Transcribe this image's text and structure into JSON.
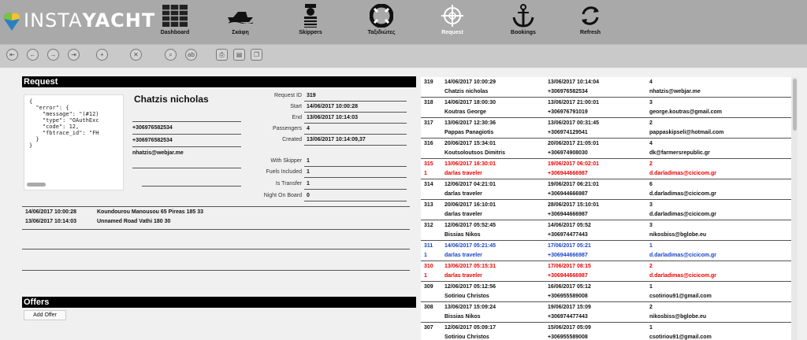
{
  "app": {
    "logo_pre": "INSTA",
    "logo_bold": "YACHT"
  },
  "nav": [
    {
      "label": "Dashboard",
      "icon": "dashboard-grid-icon"
    },
    {
      "label": "Σκάφη",
      "icon": "speedboat-icon"
    },
    {
      "label": "Skippers",
      "icon": "skipper-icon"
    },
    {
      "label": "Ταξιδιώτες",
      "icon": "lifebuoy-icon"
    },
    {
      "label": "Request",
      "icon": "compass-icon",
      "active": true
    },
    {
      "label": "Bookings",
      "icon": "anchor-icon"
    },
    {
      "label": "Refresh",
      "icon": "refresh-icon"
    }
  ],
  "toolbar": {
    "buttons": [
      "first-icon",
      "prev-icon",
      "next-icon",
      "last-icon",
      "add-icon",
      "cancel-icon",
      "search-icon",
      "find-replace-icon",
      "print-icon",
      "export-icon",
      "copy-icon"
    ]
  },
  "request": {
    "header": "Request",
    "json_text": "{\n  \"error\": {\n    \"message\": \"(#12)\n    \"type\": \"OAuthExc\n    \"code\": 12,\n    \"fbtrace_id\": \"FH\n  }\n}",
    "customer_name": "Chatzis nicholas",
    "phone1": "+306976582534",
    "phone2": "+306976582534",
    "email": "nhatzis@webjar.me",
    "fields": [
      {
        "label": "Request ID",
        "value": "319"
      },
      {
        "label": "Start",
        "value": "14/06/2017 10:00:28"
      },
      {
        "label": "End",
        "value": "13/06/2017 10:14:03"
      },
      {
        "label": "Passengers",
        "value": "4"
      },
      {
        "label": "Created",
        "value": "13/06/2017 10:14:09,37"
      },
      {
        "label": "With Skipper",
        "value": "1"
      },
      {
        "label": "Fuels Included",
        "value": "1"
      },
      {
        "label": "Is Transfer",
        "value": "1"
      },
      {
        "label": "Night On Board",
        "value": "0"
      }
    ],
    "addresses": [
      {
        "date": "14/06/2017 10:00:28",
        "address": "Koundourou Manousou 65 Pireas 185 33"
      },
      {
        "date": "13/06/2017 10:14:03",
        "address": "Unnamed Road Vathi 180 30"
      }
    ]
  },
  "offers": {
    "header": "Offers",
    "add_button": "Add Offer"
  },
  "list": [
    {
      "id": "319",
      "start": "14/06/2017 10:00:29",
      "name": "Chatzis nicholas",
      "end": "13/06/2017 10:14:04",
      "phone": "+306976582534",
      "pax": "4",
      "email": "nhatzis@webjar.me",
      "style": ""
    },
    {
      "id": "318",
      "start": "14/06/2017 18:00:30",
      "name": "Koutras George",
      "end": "13/06/2017 21:00:01",
      "phone": "+306976791019",
      "pax": "3",
      "email": "george.koutras@gmail.com",
      "style": ""
    },
    {
      "id": "317",
      "start": "13/06/2017 12:30:36",
      "name": "Pappas Panagiotis",
      "end": "13/06/2017 00:31:45",
      "phone": "+306974129541",
      "pax": "2",
      "email": "pappaskipseli@hotmail.com",
      "style": ""
    },
    {
      "id": "316",
      "start": "20/06/2017 15:34:01",
      "name": "Koutsoloutsos Dimitris",
      "end": "20/06/2017 21:05:01",
      "phone": "+306974908030",
      "pax": "4",
      "email": "dk@farmersrepublic.gr",
      "style": ""
    },
    {
      "id": "315",
      "start": "13/06/2017 16:30:01",
      "name": "darlas traveler",
      "end": "19/06/2017 06:02:01",
      "phone": "+306944666987",
      "pax": "2",
      "email": "d.darladimas@cicicom.gr",
      "style": "red",
      "sub": "1"
    },
    {
      "id": "314",
      "start": "12/06/2017 04:21:01",
      "name": "darlas traveler",
      "end": "19/06/2017 06:21:01",
      "phone": "+306944666987",
      "pax": "6",
      "email": "d.darladimas@cicicom.gr",
      "style": ""
    },
    {
      "id": "313",
      "start": "20/06/2017 16:10:01",
      "name": "darlas traveler",
      "end": "28/06/2017 15:10:01",
      "phone": "+306944666987",
      "pax": "3",
      "email": "d.darladimas@cicicom.gr",
      "style": ""
    },
    {
      "id": "312",
      "start": "12/06/2017 05:52:45",
      "name": "Bissias Nikos",
      "end": "14/06/2017 05:52",
      "phone": "+306974477443",
      "pax": "3",
      "email": "nikosbiss@bglobe.eu",
      "style": ""
    },
    {
      "id": "311",
      "start": "14/06/2017 05:21:45",
      "name": "darlas traveler",
      "end": "17/06/2017 05:21",
      "phone": "+306944666987",
      "pax": "1",
      "email": "d.darladimas@cicicom.gr",
      "style": "blue",
      "sub": "1"
    },
    {
      "id": "310",
      "start": "13/06/2017 05:15:31",
      "name": "darlas traveler",
      "end": "17/06/2017 08:15",
      "phone": "+306944666987",
      "pax": "2",
      "email": "d.darladimas@cicicom.gr",
      "style": "red",
      "sub": "1"
    },
    {
      "id": "309",
      "start": "12/06/2017 05:12:56",
      "name": "Sotiriou Christos",
      "end": "16/06/2017 05:12",
      "phone": "+306955589008",
      "pax": "1",
      "email": "csotiriou91@gmail.com",
      "style": ""
    },
    {
      "id": "308",
      "start": "13/06/2017 15:09:24",
      "name": "Bissias Nikos",
      "end": "19/06/2017 15:09",
      "phone": "+306974477443",
      "pax": "2",
      "email": "nikosbiss@bglobe.eu",
      "style": ""
    },
    {
      "id": "307",
      "start": "12/06/2017 05:09:17",
      "name": "Sotiriou Christos",
      "end": "15/06/2017 05:09",
      "phone": "+306955589008",
      "pax": "1",
      "email": "csotiriou91@gmail.com",
      "style": ""
    }
  ]
}
